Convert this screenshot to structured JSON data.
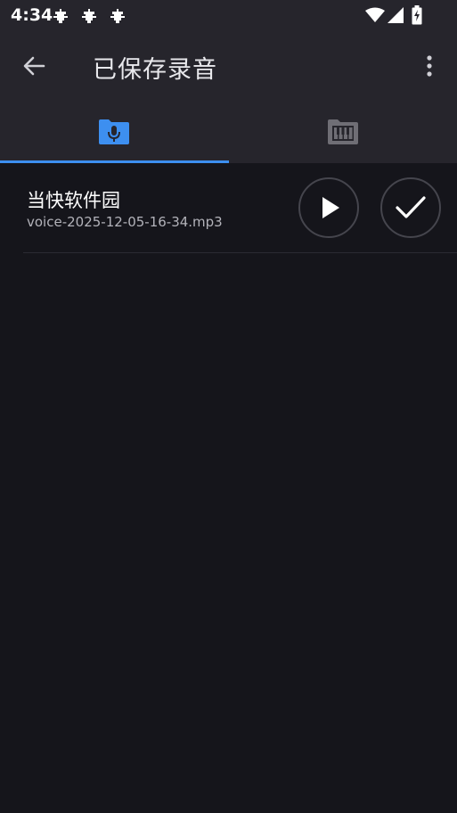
{
  "status": {
    "time": "4:34"
  },
  "appbar": {
    "title": "已保存录音",
    "back_icon": "arrow-left-icon",
    "more_icon": "more-vert-icon"
  },
  "tabs": [
    {
      "icon": "folder-mic-icon",
      "active": true
    },
    {
      "icon": "folder-piano-icon",
      "active": false
    }
  ],
  "recordings": [
    {
      "name": "当快软件园",
      "file": "voice-2025-12-05-16-34.mp3"
    }
  ],
  "colors": {
    "accent": "#3d8ff0",
    "topbar": "#26252c",
    "background": "#15151b"
  }
}
